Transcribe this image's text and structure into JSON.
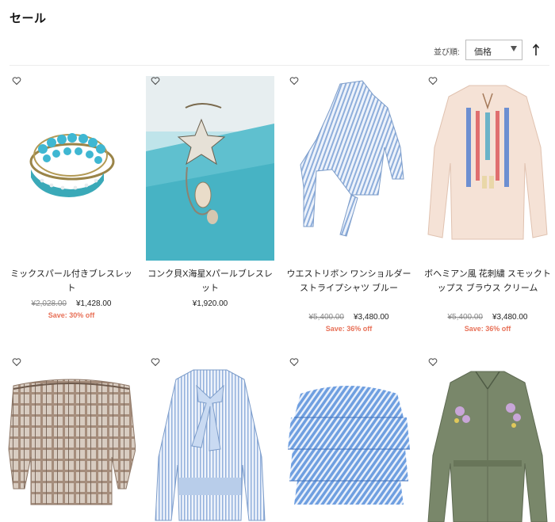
{
  "page": {
    "title": "セール"
  },
  "sort": {
    "label": "並び順:",
    "selected": "価格",
    "direction_icon": "arrow-up-icon"
  },
  "products": [
    {
      "name": "ミックスパール付きブレスレット",
      "old_price": "¥2,028.00",
      "price": "¥1,428.00",
      "save": "Save: 30% off",
      "image": "bracelet-mixed-pearl"
    },
    {
      "name": "コンク貝X海星Xパールブレスレット",
      "old_price": "",
      "price": "¥1,920.00",
      "save": "",
      "image": "bracelet-starfish"
    },
    {
      "name": "ウエストリボン ワンショルダー ストライプシャツ ブルー",
      "old_price": "¥5,400.00",
      "price": "¥3,480.00",
      "save": "Save: 36% off",
      "image": "blue-stripe-one-shoulder-shirt"
    },
    {
      "name": "ボヘミアン風 花刺繍 スモックトップス ブラウス クリーム",
      "old_price": "¥5,400.00",
      "price": "¥3,480.00",
      "save": "Save: 36% off",
      "image": "cream-embroidered-blouse"
    },
    {
      "name": "",
      "old_price": "",
      "price": "",
      "save": "",
      "image": "plaid-off-shoulder-top"
    },
    {
      "name": "",
      "old_price": "",
      "price": "",
      "save": "",
      "image": "blue-stripe-bow-blouse"
    },
    {
      "name": "",
      "old_price": "",
      "price": "",
      "save": "",
      "image": "blue-ruffle-off-shoulder-dress"
    },
    {
      "name": "",
      "old_price": "",
      "price": "",
      "save": "",
      "image": "olive-embroidered-shirt-dress"
    }
  ],
  "colors": {
    "sale": "#e87158",
    "divider": "#ececec"
  }
}
